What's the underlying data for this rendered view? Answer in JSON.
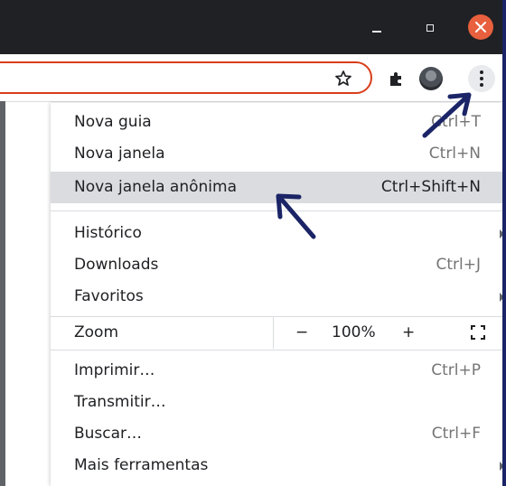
{
  "menu": {
    "items": [
      {
        "label": "Nova guia",
        "shortcut": "Ctrl+T"
      },
      {
        "label": "Nova janela",
        "shortcut": "Ctrl+N"
      },
      {
        "label": "Nova janela anônima",
        "shortcut": "Ctrl+Shift+N"
      },
      {
        "label": "Histórico",
        "shortcut": ""
      },
      {
        "label": "Downloads",
        "shortcut": "Ctrl+J"
      },
      {
        "label": "Favoritos",
        "shortcut": ""
      },
      {
        "label": "Imprimir…",
        "shortcut": "Ctrl+P"
      },
      {
        "label": "Transmitir…",
        "shortcut": ""
      },
      {
        "label": "Buscar…",
        "shortcut": "Ctrl+F"
      },
      {
        "label": "Mais ferramentas",
        "shortcut": ""
      }
    ],
    "zoom": {
      "label": "Zoom",
      "minus": "−",
      "value": "100%",
      "plus": "+"
    }
  },
  "icons": {
    "star": "star-icon",
    "extensions": "puzzle-icon",
    "menu": "three-dots-vertical-icon",
    "fullscreen": "fullscreen-icon"
  },
  "colors": {
    "annotation_arrow": "#1a2466",
    "close_button": "#e8603d",
    "omnibox_border": "#d93d1a",
    "highlight_row": "#dadce0"
  }
}
